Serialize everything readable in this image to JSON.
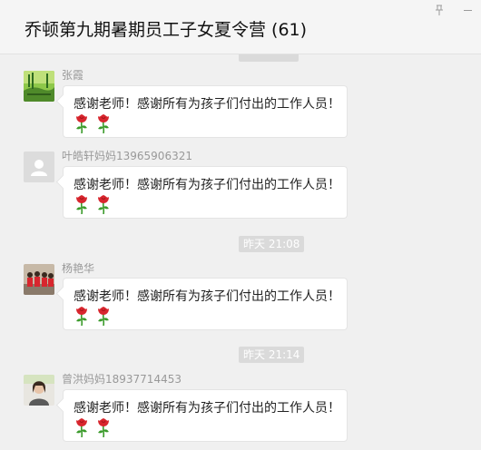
{
  "window": {
    "title": "乔顿第九期暑期员工子女夏令营 (61)",
    "pin_icon": "pin-icon",
    "minimize_icon": "minimize-icon"
  },
  "colors": {
    "background": "#f0f0f0",
    "bubble": "#ffffff",
    "timestamp_bg": "#dadada",
    "rose_red": "#d8262e",
    "rose_green": "#3a9a2a"
  },
  "messages": [
    {
      "sender": "张霞",
      "text": "感谢老师！感谢所有为孩子们付出的工作人员！",
      "emojis": [
        "rose",
        "rose"
      ],
      "avatar": "avatar-landscape-icon"
    },
    {
      "sender": "叶皓轩妈妈13965906321",
      "text": "感谢老师！感谢所有为孩子们付出的工作人员！",
      "emojis": [
        "rose",
        "rose"
      ],
      "avatar": "default-avatar-icon"
    },
    {
      "timestamp": "昨天 21:08"
    },
    {
      "sender": "杨艳华",
      "text": "感谢老师！感谢所有为孩子们付出的工作人员！",
      "emojis": [
        "rose",
        "rose"
      ],
      "avatar": "avatar-group-photo-icon"
    },
    {
      "timestamp": "昨天 21:14"
    },
    {
      "sender": "曾洪妈妈18937714453",
      "text": "感谢老师！感谢所有为孩子们付出的工作人员！",
      "emojis": [
        "rose",
        "rose"
      ],
      "avatar": "avatar-portrait-icon"
    }
  ]
}
